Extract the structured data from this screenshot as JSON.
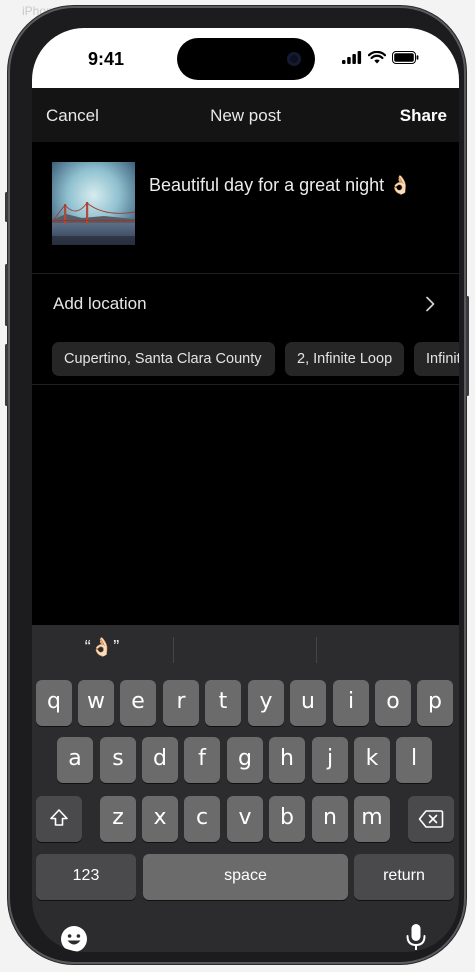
{
  "device": {
    "label": "iPhone 15 Pro"
  },
  "status_bar": {
    "time": "9:41"
  },
  "nav": {
    "cancel": "Cancel",
    "title": "New post",
    "share": "Share"
  },
  "post": {
    "caption": "Beautiful day for a great night 👌🏻"
  },
  "location": {
    "label": "Add location"
  },
  "chips": [
    "Cupertino, Santa Clara County",
    "2, Infinite Loop",
    "Infinite Loop"
  ],
  "keyboard": {
    "suggestions": [
      "“👌🏻”",
      "",
      ""
    ],
    "row1": [
      "q",
      "w",
      "e",
      "r",
      "t",
      "y",
      "u",
      "i",
      "o",
      "p"
    ],
    "row2": [
      "a",
      "s",
      "d",
      "f",
      "g",
      "h",
      "j",
      "k",
      "l"
    ],
    "row3": [
      "z",
      "x",
      "c",
      "v",
      "b",
      "n",
      "m"
    ],
    "numbers_key": "123",
    "space_key": "space",
    "return_key": "return"
  },
  "icons": {
    "status": [
      "cellular-signal-icon",
      "wifi-icon",
      "battery-icon"
    ],
    "chevron": "chevron-right-icon",
    "shift": "shift-icon",
    "delete": "delete-icon",
    "emoji": "emoji-icon",
    "mic": "microphone-icon"
  }
}
